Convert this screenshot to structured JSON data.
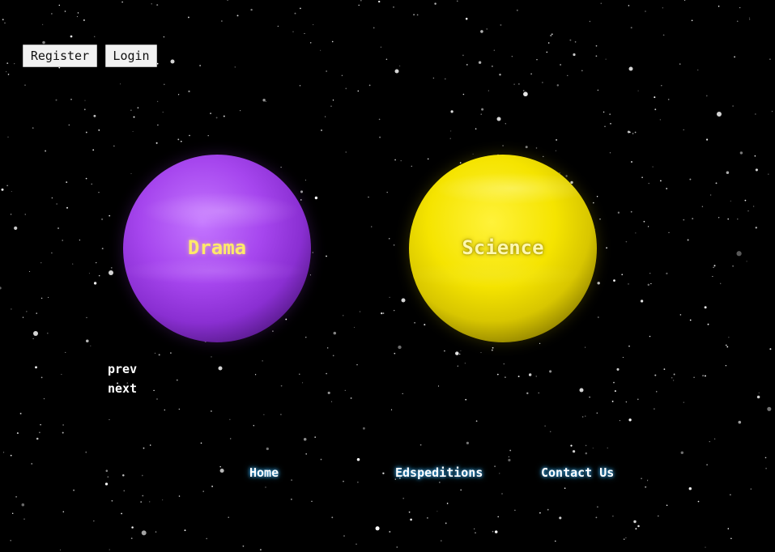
{
  "auth": {
    "register_label": "Register",
    "login_label": "Login"
  },
  "planets": [
    {
      "label": "Drama",
      "color": "#a646ee",
      "label_color": "#ffe96a"
    },
    {
      "label": "Science",
      "color": "#f5e400",
      "label_color": "#fff8b0"
    }
  ],
  "pager": {
    "prev_label": "prev",
    "next_label": "next"
  },
  "nav": {
    "items": [
      {
        "label": "Home"
      },
      {
        "label": "Edspeditions"
      },
      {
        "label": "Contact Us"
      }
    ],
    "glow_color": "#3fb6ff"
  },
  "theme": {
    "background": "#000000"
  }
}
